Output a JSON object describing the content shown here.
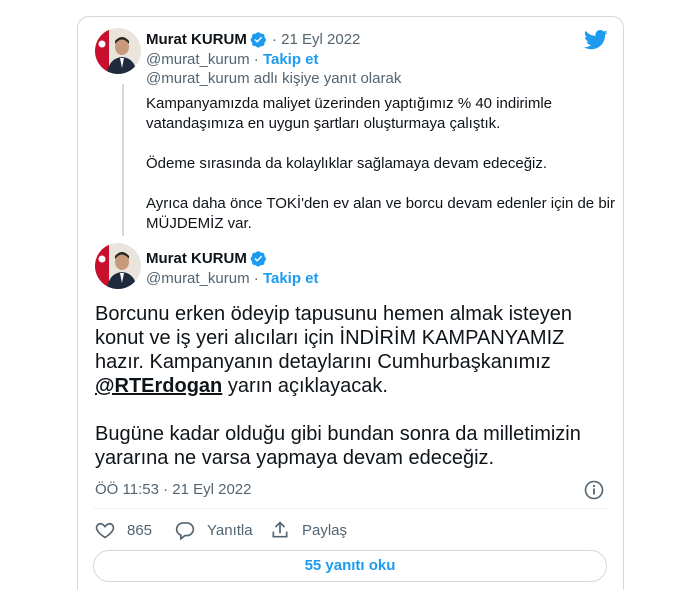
{
  "colors": {
    "accent": "#1d9bf0",
    "text": "#0f1419",
    "muted": "#536471",
    "border": "#cfd9de"
  },
  "quoted_tweet": {
    "author_name": "Murat KURUM",
    "date": "21 Eyl 2022",
    "date_sep": "·",
    "handle": "@murat_kurum",
    "follow": "Takip et",
    "reply_to": "@murat_kurum adlı kişiye yanıt olarak",
    "paragraphs": [
      "Kampanyamızda maliyet üzerinden yaptığımız % 40 indirimle vatandaşımıza en uygun şartları oluşturmaya çalıştık.",
      "Ödeme sırasında da kolaylıklar sağlamaya devam edeceğiz.",
      "Ayrıca daha önce TOKİ'den ev alan ve borcu devam edenler için de bir MÜJDEMİZ var."
    ]
  },
  "main_tweet": {
    "author_name": "Murat KURUM",
    "handle": "@murat_kurum",
    "follow": "Takip et",
    "para1": "Borcunu erken ödeyip tapusunu hemen almak isteyen konut ve iş yeri alıcıları için İNDİRİM KAMPANYAMIZ hazır. Kampanyanın detaylarını Cumhurbaşkanımız",
    "mention": "@RTErdogan",
    "para1_tail": " yarın açıklayacak.",
    "para2": "Bugüne kadar olduğu gibi bundan sonra da milletimizin yararına ne varsa yapmaya devam edeceğiz.",
    "timestamp": "ÖÖ 11:53 · 21 Eyl 2022"
  },
  "actions": {
    "likes": "865",
    "reply": "Yanıtla",
    "share": "Paylaş"
  },
  "read_replies": "55 yanıtı oku"
}
